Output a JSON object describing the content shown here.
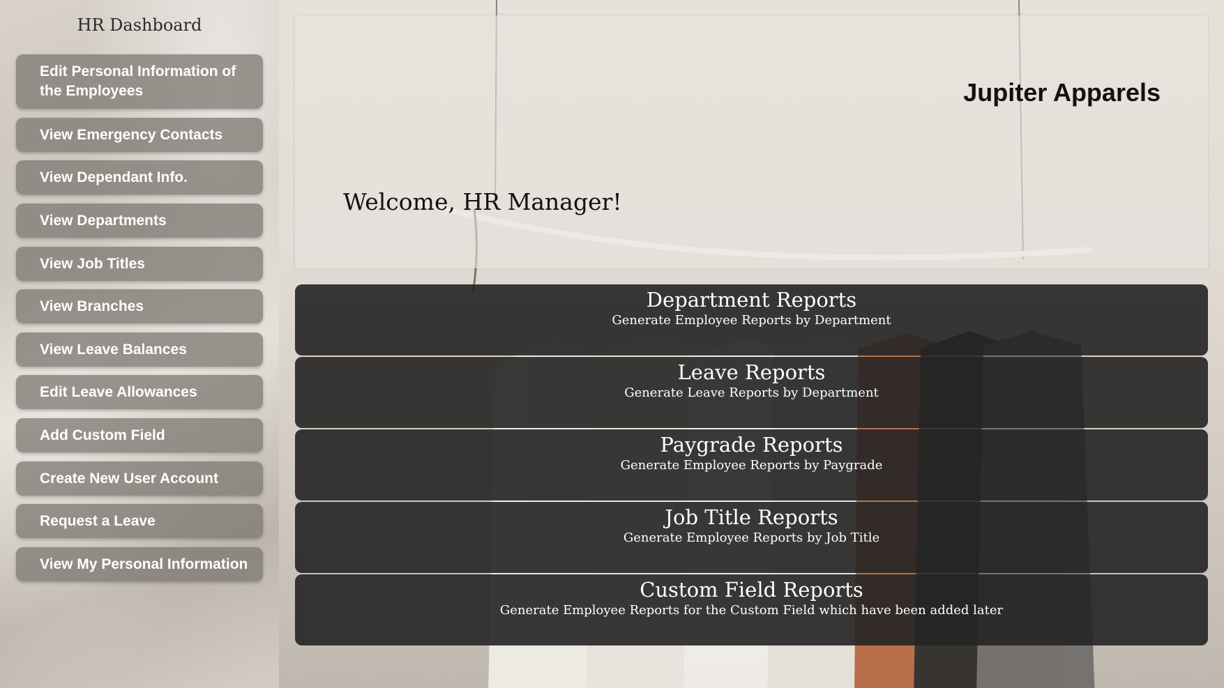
{
  "sidebar": {
    "title": "HR Dashboard",
    "items": [
      {
        "label": "Edit Personal Information of the Employees"
      },
      {
        "label": "View Emergency Contacts"
      },
      {
        "label": "View Dependant Info."
      },
      {
        "label": "View Departments"
      },
      {
        "label": "View Job Titles"
      },
      {
        "label": "View Branches"
      },
      {
        "label": "View Leave Balances"
      },
      {
        "label": "Edit Leave Allowances"
      },
      {
        "label": "Add Custom Field"
      },
      {
        "label": "Create New User Account"
      },
      {
        "label": "Request a Leave"
      },
      {
        "label": "View My Personal Information"
      }
    ]
  },
  "header": {
    "brand": "Jupiter Apparels",
    "welcome": "Welcome, HR Manager!"
  },
  "reports": [
    {
      "title": "Department Reports",
      "desc": "Generate Employee Reports by Department"
    },
    {
      "title": "Leave Reports",
      "desc": "Generate Leave Reports by Department"
    },
    {
      "title": "Paygrade Reports",
      "desc": "Generate Employee Reports by Paygrade"
    },
    {
      "title": "Job Title Reports",
      "desc": "Generate Employee Reports by Job Title"
    },
    {
      "title": "Custom Field Reports",
      "desc": "Generate Employee Reports for the Custom Field which have been added later"
    }
  ],
  "colors": {
    "sidebar_button": "#78746e",
    "report_card": "#242424",
    "text_light": "#ffffff",
    "text_dark": "#111111"
  }
}
